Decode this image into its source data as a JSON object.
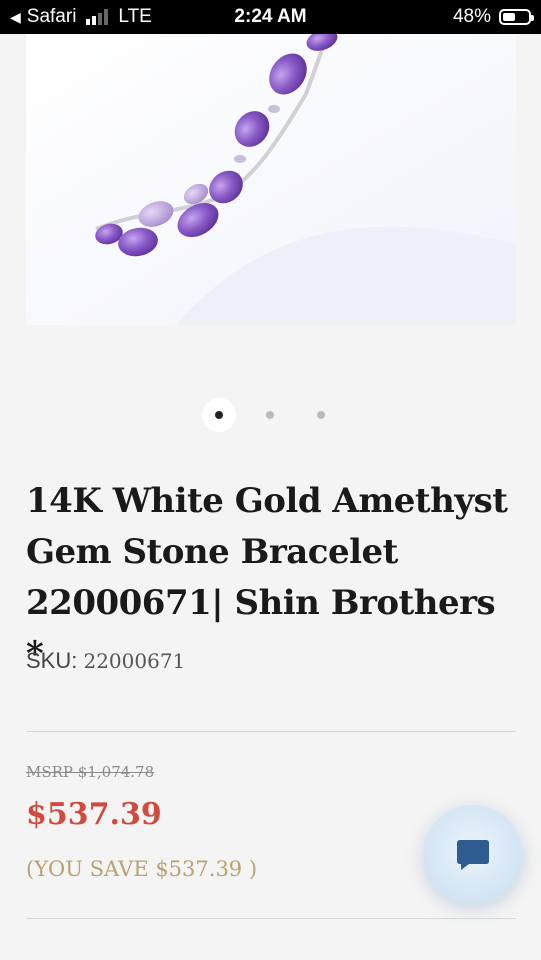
{
  "status_bar": {
    "back_app": "Safari",
    "network": "LTE",
    "time": "2:24 AM",
    "battery": "48%",
    "battery_level": 0.48
  },
  "gallery": {
    "image_count": 3,
    "active_index": 0
  },
  "product": {
    "title": "14K White Gold Amethyst Gem Stone Bracelet 22000671| Shin Brothers *",
    "sku_label": "SKU:",
    "sku_value": "22000671",
    "msrp": "MSRP $1,074.78",
    "price": "$537.39",
    "you_save": "(YOU SAVE $537.39 )"
  },
  "colors": {
    "price": "#d24a3b",
    "save": "#b9a26c",
    "amethyst": "#8a5cc7"
  },
  "icons": {
    "chat": "chat-bubble-icon",
    "back": "back-arrow-icon",
    "signal": "cellular-signal-icon",
    "battery": "battery-icon"
  }
}
